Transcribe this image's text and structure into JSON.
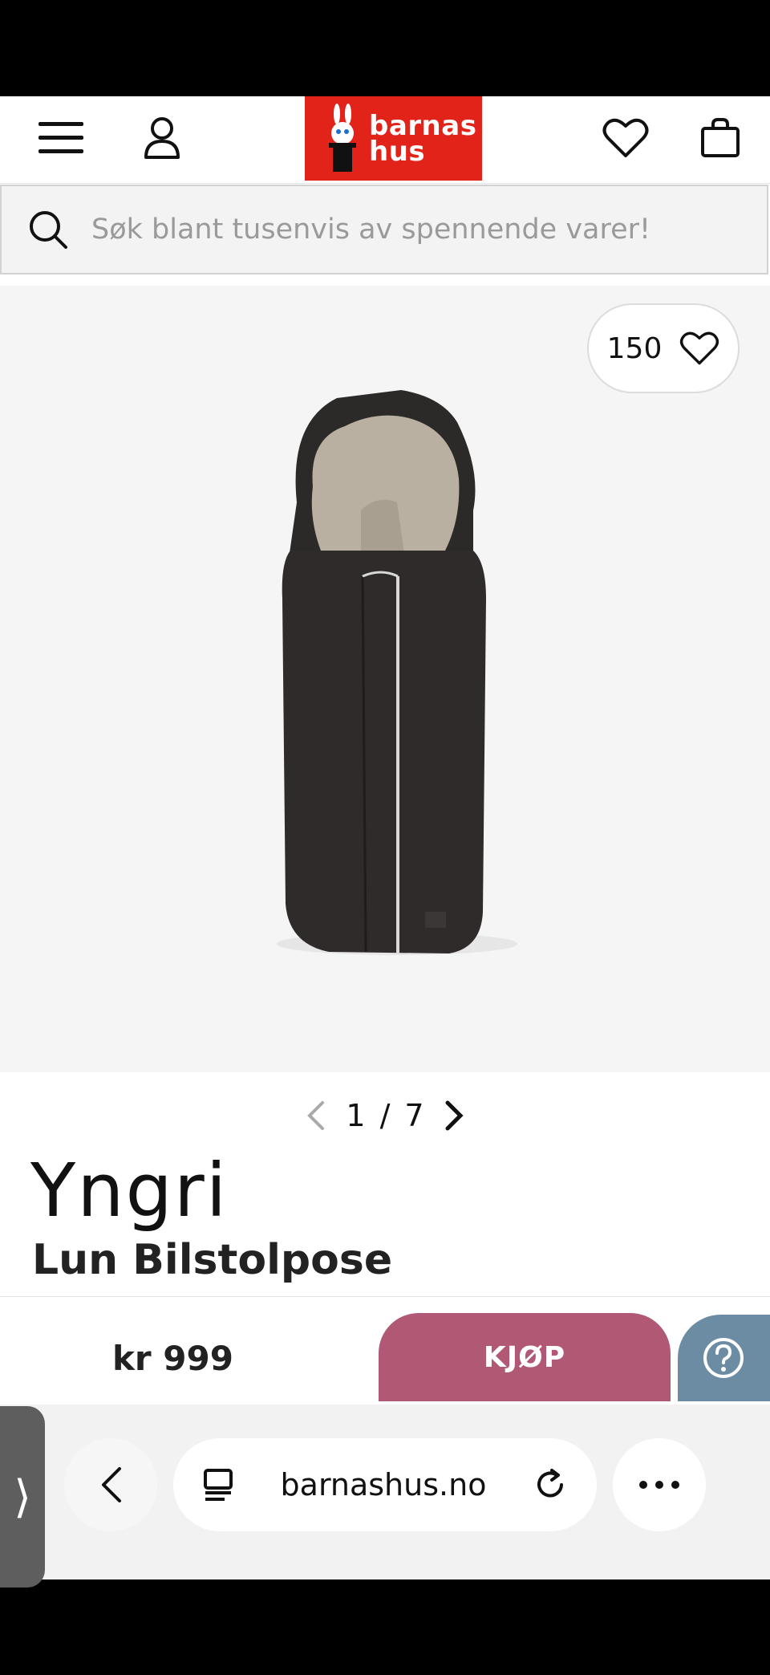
{
  "header": {
    "menu_icon": "hamburger-menu-icon",
    "account_icon": "user-icon",
    "logo": {
      "line1": "barnas",
      "line2": "hus",
      "color": "#e2231a"
    },
    "wishlist_icon": "heart-icon",
    "cart_icon": "shopping-bag-icon"
  },
  "search": {
    "placeholder": "Søk blant tusenvis av spennende varer!",
    "icon": "search-icon"
  },
  "gallery": {
    "favorite_count": "150",
    "pager": {
      "current": "1",
      "separator": "/",
      "total": "7"
    }
  },
  "product": {
    "brand": "Yngri",
    "title": "Lun Bilstolpose",
    "price": "kr 999"
  },
  "actions": {
    "buy_label": "KJØP",
    "buy_color": "#b05874",
    "help_color": "#6c8ca4"
  },
  "browser": {
    "url": "barnashus.no",
    "side_tab_glyph": "⟩"
  }
}
